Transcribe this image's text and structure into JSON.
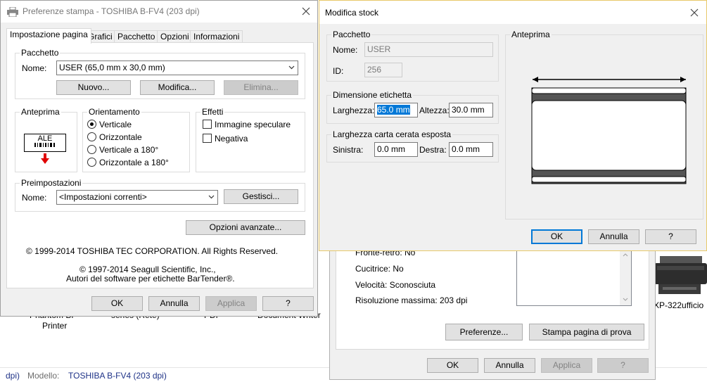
{
  "background": {
    "status_bar": {
      "prefix": "dpi)",
      "model_label": "Modello:",
      "model_value": "TOSHIBA B-FV4 (203 dpi)"
    },
    "desktop_labels": {
      "pdf_printer_line1": "Phantom BF",
      "pdf_printer_line2": "Printer",
      "series": "series (Rete)",
      "pdf": "PDF",
      "document_writer": "Document Writer",
      "epson": "XP-322ufficio"
    }
  },
  "props_dialog": {
    "duplex": "Fronte-retro: No",
    "stapler": "Cucitrice: No",
    "speed": "Velocità: Sconosciuta",
    "resolution": "Risoluzione massima: 203 dpi",
    "preferences_button": "Preferenze...",
    "test_page_button": "Stampa pagina di prova",
    "ok": "OK",
    "cancel": "Annulla",
    "apply": "Applica",
    "help": "?"
  },
  "prefs_dialog": {
    "title": "Preferenze stampa - TOSHIBA B-FV4 (203 dpi)",
    "tabs": [
      "Impostazione pagina",
      "Grafici",
      "Pacchetto",
      "Opzioni",
      "Informazioni"
    ],
    "active_tab": 0,
    "package": {
      "legend": "Pacchetto",
      "name_label": "Nome:",
      "name_value": "USER (65,0 mm x 30,0 mm)",
      "new_button": "Nuovo...",
      "edit_button": "Modifica...",
      "delete_button": "Elimina..."
    },
    "preview": {
      "legend": "Anteprima",
      "sample_text": "ALE"
    },
    "orientation": {
      "legend": "Orientamento",
      "options": [
        "Verticale",
        "Orizzontale",
        "Verticale a 180°",
        "Orizzontale a 180°"
      ],
      "selected": 0
    },
    "effects": {
      "legend": "Effetti",
      "mirror": "Immagine speculare",
      "negative": "Negativa"
    },
    "presets": {
      "legend": "Preimpostazioni",
      "name_label": "Nome:",
      "name_value": "<Impostazioni correnti>",
      "manage_button": "Gestisci..."
    },
    "advanced_button": "Opzioni avanzate...",
    "copyright1": "© 1999-2014 TOSHIBA TEC CORPORATION.  All Rights Reserved.",
    "copyright2": "© 1997-2014 Seagull Scientific, Inc.,",
    "copyright3": "Autori del software per etichette BarTender®.",
    "ok": "OK",
    "cancel": "Annulla",
    "apply": "Applica",
    "help": "?"
  },
  "stock_dialog": {
    "title": "Modifica stock",
    "package": {
      "legend": "Pacchetto",
      "name_label": "Nome:",
      "name_value": "USER",
      "id_label": "ID:",
      "id_value": "256"
    },
    "label_size": {
      "legend": "Dimensione etichetta",
      "width_label": "Larghezza:",
      "width_value": "65.0 mm",
      "height_label": "Altezza:",
      "height_value": "30.0 mm"
    },
    "liner": {
      "legend": "Larghezza carta cerata esposta",
      "left_label": "Sinistra:",
      "left_value": "0.0 mm",
      "right_label": "Destra:",
      "right_value": "0.0 mm"
    },
    "preview_legend": "Anteprima",
    "ok": "OK",
    "cancel": "Annulla",
    "help": "?"
  },
  "colors": {
    "window_bg": "#f0f0f0",
    "accent": "#0078d7",
    "stock_border": "#e8c96a",
    "arrow_red": "#e00000"
  }
}
